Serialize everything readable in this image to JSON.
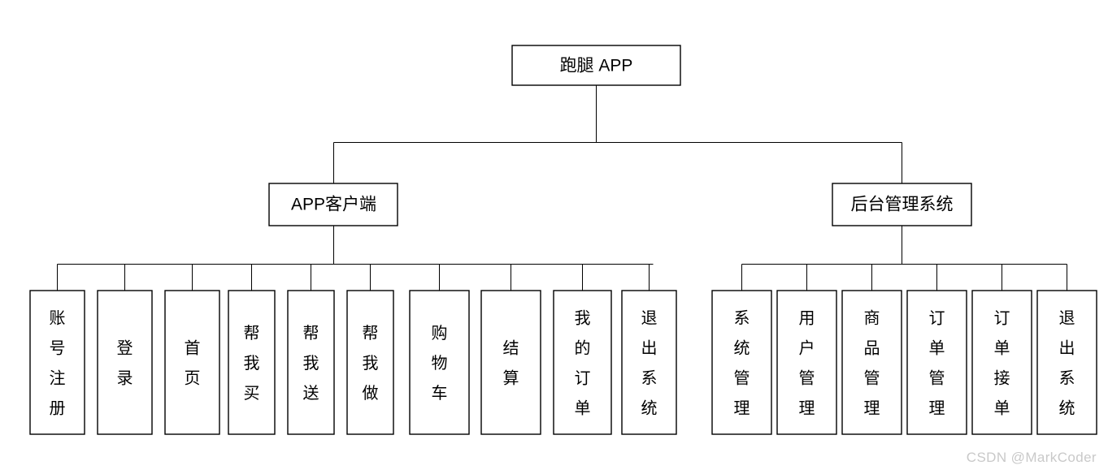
{
  "diagram": {
    "type": "tree",
    "orientation": "top-down",
    "root": {
      "label": "跑腿 APP",
      "text_direction": "horizontal"
    },
    "branches": [
      {
        "label": "APP客户端",
        "text_direction": "horizontal",
        "children": [
          {
            "label": "账号注册",
            "text_direction": "vertical"
          },
          {
            "label": "登录",
            "text_direction": "vertical"
          },
          {
            "label": "首页",
            "text_direction": "vertical"
          },
          {
            "label": "帮我买",
            "text_direction": "vertical"
          },
          {
            "label": "帮我送",
            "text_direction": "vertical"
          },
          {
            "label": "帮我做",
            "text_direction": "vertical"
          },
          {
            "label": "购物车",
            "text_direction": "vertical"
          },
          {
            "label": "结算",
            "text_direction": "vertical"
          },
          {
            "label": "我的订单",
            "text_direction": "vertical"
          },
          {
            "label": "退出系统",
            "text_direction": "vertical"
          }
        ]
      },
      {
        "label": "后台管理系统",
        "text_direction": "horizontal",
        "children": [
          {
            "label": "系统管理",
            "text_direction": "vertical"
          },
          {
            "label": "用户管理",
            "text_direction": "vertical"
          },
          {
            "label": "商品管理",
            "text_direction": "vertical"
          },
          {
            "label": "订单管理",
            "text_direction": "vertical"
          },
          {
            "label": "订单接单",
            "text_direction": "vertical"
          },
          {
            "label": "退出系统",
            "text_direction": "vertical"
          }
        ]
      }
    ],
    "colors": {
      "background": "#ffffff",
      "box_fill": "#ffffff",
      "box_stroke": "#000000",
      "text": "#000000",
      "watermark": "#c9c9c9"
    }
  },
  "watermark": {
    "text": "CSDN @MarkCoder"
  }
}
